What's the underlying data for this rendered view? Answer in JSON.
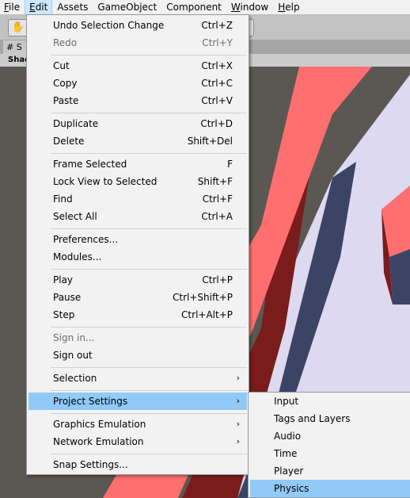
{
  "menubar": [
    {
      "label": "File",
      "u": "F",
      "rest": "ile"
    },
    {
      "label": "Edit",
      "u": "E",
      "rest": "dit"
    },
    {
      "label": "Assets"
    },
    {
      "label": "GameObject"
    },
    {
      "label": "Component"
    },
    {
      "label": "Window",
      "u": "W",
      "rest": "indow"
    },
    {
      "label": "Help",
      "u": "H",
      "rest": "elp"
    }
  ],
  "toolbar": {
    "hand_icon": "hand-icon",
    "hand_glyph": "✋"
  },
  "scene": {
    "tab_label": "# S",
    "shading_label": "Shad"
  },
  "edit_menu": {
    "undo": {
      "label": "Undo Selection Change",
      "shortcut": "Ctrl+Z"
    },
    "redo": {
      "label": "Redo",
      "shortcut": "Ctrl+Y"
    },
    "cut": {
      "label": "Cut",
      "shortcut": "Ctrl+X"
    },
    "copy": {
      "label": "Copy",
      "shortcut": "Ctrl+C"
    },
    "paste": {
      "label": "Paste",
      "shortcut": "Ctrl+V"
    },
    "duplicate": {
      "label": "Duplicate",
      "shortcut": "Ctrl+D"
    },
    "delete": {
      "label": "Delete",
      "shortcut": "Shift+Del"
    },
    "frame_selected": {
      "label": "Frame Selected",
      "shortcut": "F"
    },
    "lock_view": {
      "label": "Lock View to Selected",
      "shortcut": "Shift+F"
    },
    "find": {
      "label": "Find",
      "shortcut": "Ctrl+F"
    },
    "select_all": {
      "label": "Select All",
      "shortcut": "Ctrl+A"
    },
    "preferences": {
      "label": "Preferences..."
    },
    "modules": {
      "label": "Modules..."
    },
    "play": {
      "label": "Play",
      "shortcut": "Ctrl+P"
    },
    "pause": {
      "label": "Pause",
      "shortcut": "Ctrl+Shift+P"
    },
    "step": {
      "label": "Step",
      "shortcut": "Ctrl+Alt+P"
    },
    "sign_in": {
      "label": "Sign in..."
    },
    "sign_out": {
      "label": "Sign out"
    },
    "selection": {
      "label": "Selection"
    },
    "project_settings": {
      "label": "Project Settings"
    },
    "graphics_emulation": {
      "label": "Graphics Emulation"
    },
    "network_emulation": {
      "label": "Network Emulation"
    },
    "snap_settings": {
      "label": "Snap Settings..."
    },
    "submenu_arrow": "›"
  },
  "project_settings_submenu": {
    "input": "Input",
    "tags_layers": "Tags and Layers",
    "audio": "Audio",
    "time": "Time",
    "player": "Player",
    "physics": "Physics"
  },
  "colors": {
    "highlight": "#91c9f7",
    "menubar_active": "#cce8ff",
    "red_face": "#ff7070",
    "dark_red": "#8b1e1e",
    "navy": "#3d4565",
    "sky": "#dedcf2"
  }
}
